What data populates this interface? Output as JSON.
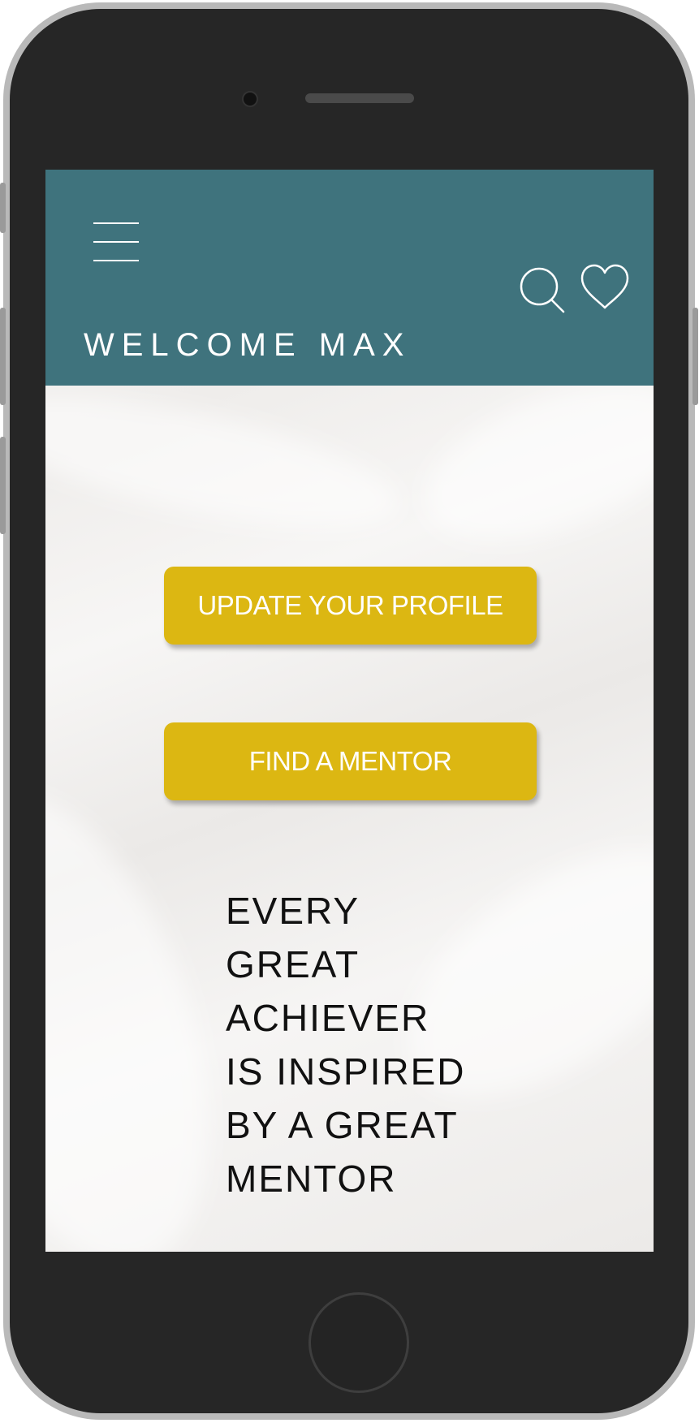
{
  "header": {
    "welcome_text": "WELCOME MAX",
    "background_color": "#3f737d",
    "icons": [
      "menu-icon",
      "search-icon",
      "heart-icon"
    ]
  },
  "actions": {
    "update_profile_label": "UPDATE YOUR PROFILE",
    "find_mentor_label": "FIND A MENTOR",
    "button_color": "#dcb712"
  },
  "quote": {
    "lines": [
      "EVERY",
      "GREAT",
      "ACHIEVER",
      "IS INSPIRED",
      "BY A GREAT",
      "MENTOR"
    ]
  }
}
